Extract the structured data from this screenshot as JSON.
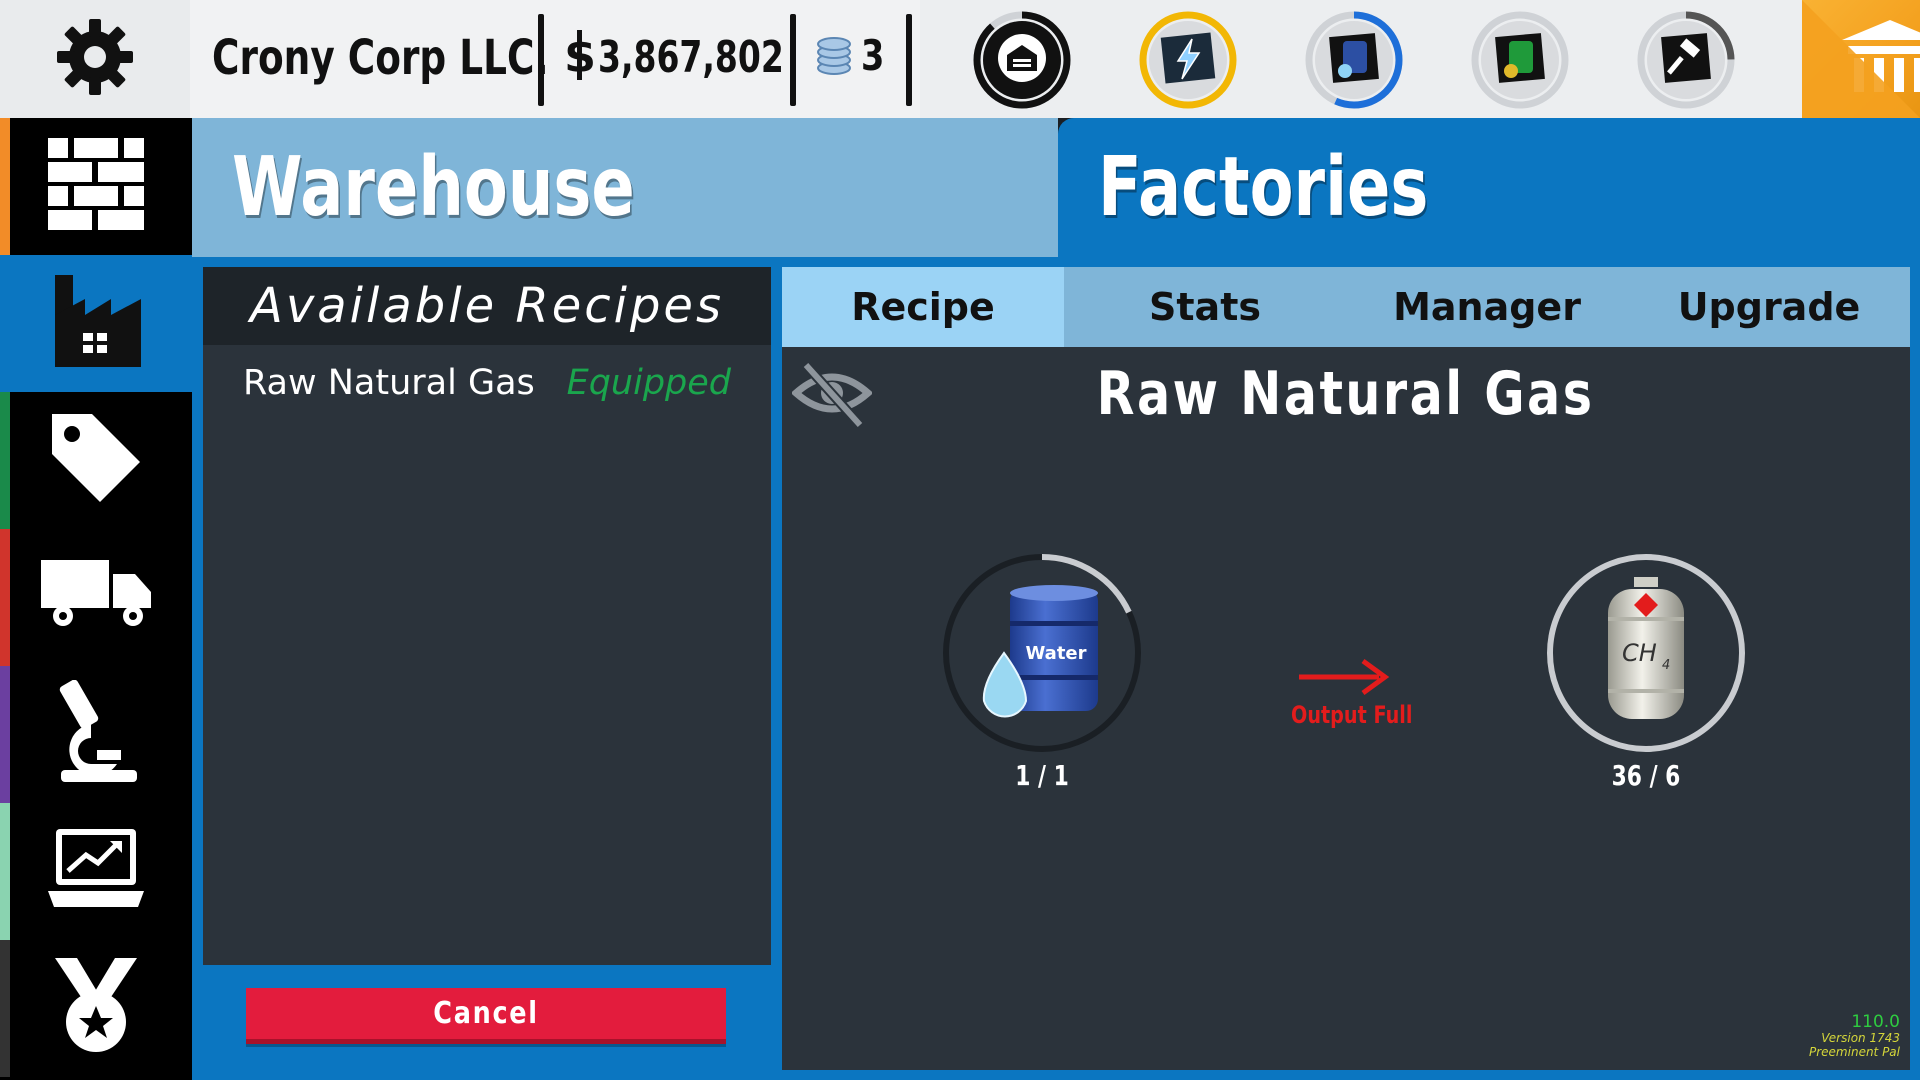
{
  "topbar": {
    "company": "Crony Corp LLC.",
    "money": "3,867,802",
    "credits": "3",
    "production_icons": [
      {
        "name": "warehouse-storage-icon",
        "ring_color": "#111111"
      },
      {
        "name": "power-energy-icon",
        "ring_color": "#f2b705"
      },
      {
        "name": "water-barrel-icon",
        "ring_color": "#1e6fd9"
      },
      {
        "name": "diesel-barrel-icon",
        "ring_color": "#c8c8c8"
      },
      {
        "name": "auction-gavel-icon",
        "ring_color": "#666666"
      }
    ]
  },
  "sidebar": {
    "items": [
      {
        "name": "warehouse-nav",
        "stripe": "#f28c28"
      },
      {
        "name": "factories-nav",
        "stripe": "#0b76c1"
      },
      {
        "name": "sales-nav",
        "stripe": "#1a8a4a"
      },
      {
        "name": "logistics-nav",
        "stripe": "#d0342c"
      },
      {
        "name": "research-nav",
        "stripe": "#6b3fa0"
      },
      {
        "name": "market-nav",
        "stripe": "#8ad3b0"
      },
      {
        "name": "achievements-nav",
        "stripe": "#333333"
      }
    ]
  },
  "tabs": {
    "warehouse": "Warehouse",
    "factories": "Factories"
  },
  "recipes": {
    "title": "Available Recipes",
    "items": [
      {
        "name": "Raw Natural Gas",
        "status": "Equipped"
      }
    ],
    "cancel": "Cancel"
  },
  "detail": {
    "subtabs": [
      "Recipe",
      "Stats",
      "Manager",
      "Upgrade"
    ],
    "active_subtab": "Recipe",
    "title": "Raw Natural Gas",
    "input": {
      "label": "Water",
      "count": "1 / 1",
      "progress": 0.18
    },
    "output": {
      "label": "CH4",
      "count": "36 / 6",
      "progress": 1.0
    },
    "output_status": "Output Full"
  },
  "version": {
    "number": "110.0",
    "build": "Version 1743",
    "tag": "Preeminent Pal"
  },
  "colors": {
    "accent_blue": "#0b76c1",
    "light_blue": "#7fb5d8",
    "panel": "#2b333b",
    "cancel_red": "#e31c3d",
    "equipped_green": "#1aa64d"
  }
}
